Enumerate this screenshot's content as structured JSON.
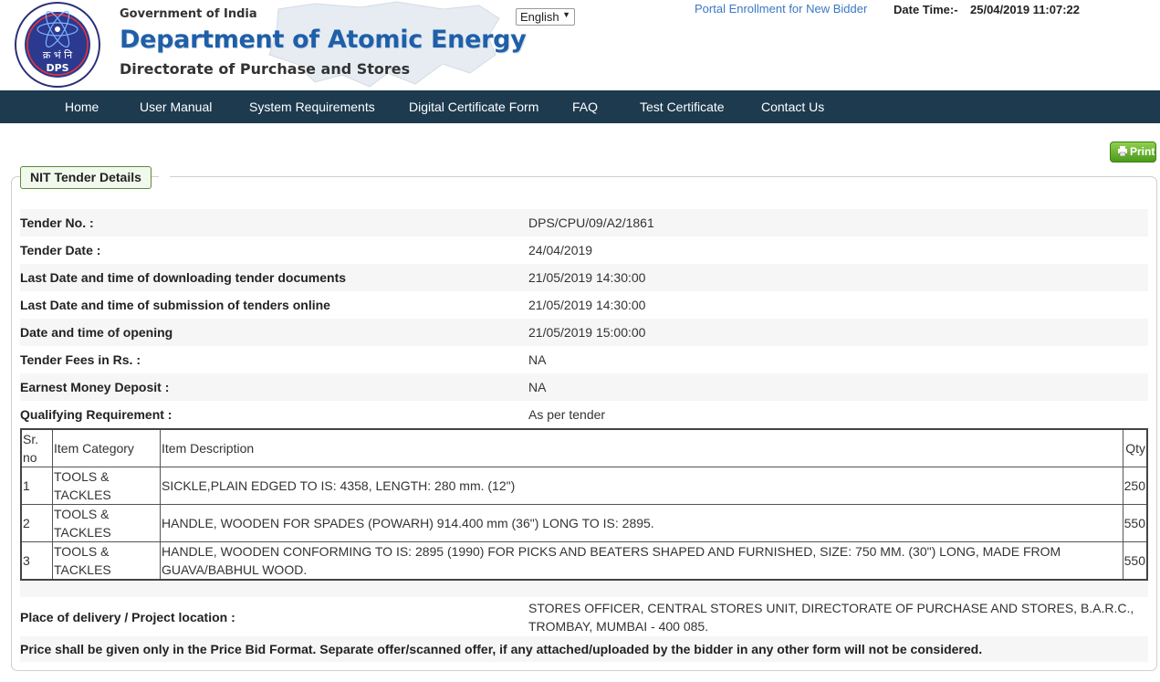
{
  "header": {
    "logo_text": "क्र भं नि DPS",
    "gov_text": "Government of India",
    "dept_title": "Department of Atomic Energy",
    "directorate": "Directorate of Purchase and Stores",
    "language": "English",
    "portal_link": "Portal Enrollment for New Bidder",
    "date_time_label": "Date Time:-",
    "date_time_value": "25/04/2019 11:07:22"
  },
  "nav": {
    "items": [
      "Home",
      "User Manual",
      "System Requirements",
      "Digital Certificate Form",
      "FAQ",
      "Test Certificate",
      "Contact Us"
    ]
  },
  "print_label": "Print",
  "section_title": "NIT Tender Details",
  "details": [
    {
      "label": "Tender No. :",
      "value": "DPS/CPU/09/A2/1861"
    },
    {
      "label": "Tender Date :",
      "value": "24/04/2019"
    },
    {
      "label": "Last Date and time of downloading tender documents",
      "value": "21/05/2019 14:30:00"
    },
    {
      "label": "Last Date and time of submission of tenders online",
      "value": "21/05/2019 14:30:00"
    },
    {
      "label": "Date and time of opening",
      "value": "21/05/2019 15:00:00"
    },
    {
      "label": "Tender Fees in Rs. :",
      "value": "NA"
    },
    {
      "label": "Earnest Money Deposit :",
      "value": "NA"
    },
    {
      "label": "Qualifying Requirement :",
      "value": "As per tender"
    }
  ],
  "items_table": {
    "headers": [
      "Sr. no",
      "Item Category",
      "Item Description",
      "Qty"
    ],
    "rows": [
      [
        "1",
        "TOOLS & TACKLES",
        "SICKLE,PLAIN EDGED TO IS: 4358, LENGTH: 280 mm. (12\")",
        "250"
      ],
      [
        "2",
        "TOOLS & TACKLES",
        "HANDLE, WOODEN FOR SPADES (POWARH) 914.400 mm (36\") LONG TO IS: 2895.",
        "550"
      ],
      [
        "3",
        "TOOLS & TACKLES",
        "HANDLE, WOODEN CONFORMING TO IS: 2895 (1990) FOR PICKS AND BEATERS SHAPED AND FURNISHED, SIZE: 750 MM. (30\") LONG, MADE FROM GUAVA/BABHUL WOOD.",
        "550"
      ]
    ]
  },
  "place": {
    "label": "Place of delivery / Project location :",
    "value": "STORES OFFICER, CENTRAL STORES UNIT, DIRECTORATE OF PURCHASE AND STORES, B.A.R.C., TROMBAY, MUMBAI - 400 085."
  },
  "note": "Price shall be given only in the Price Bid Format. Separate offer/scanned offer, if any attached/uploaded by the bidder in any other form will not be considered.",
  "colors": {
    "nav_bg": "#1d3a4f",
    "dept_blue": "#1f5fa8",
    "link_blue": "#3a78c4",
    "print_green": "#6bb33a"
  }
}
